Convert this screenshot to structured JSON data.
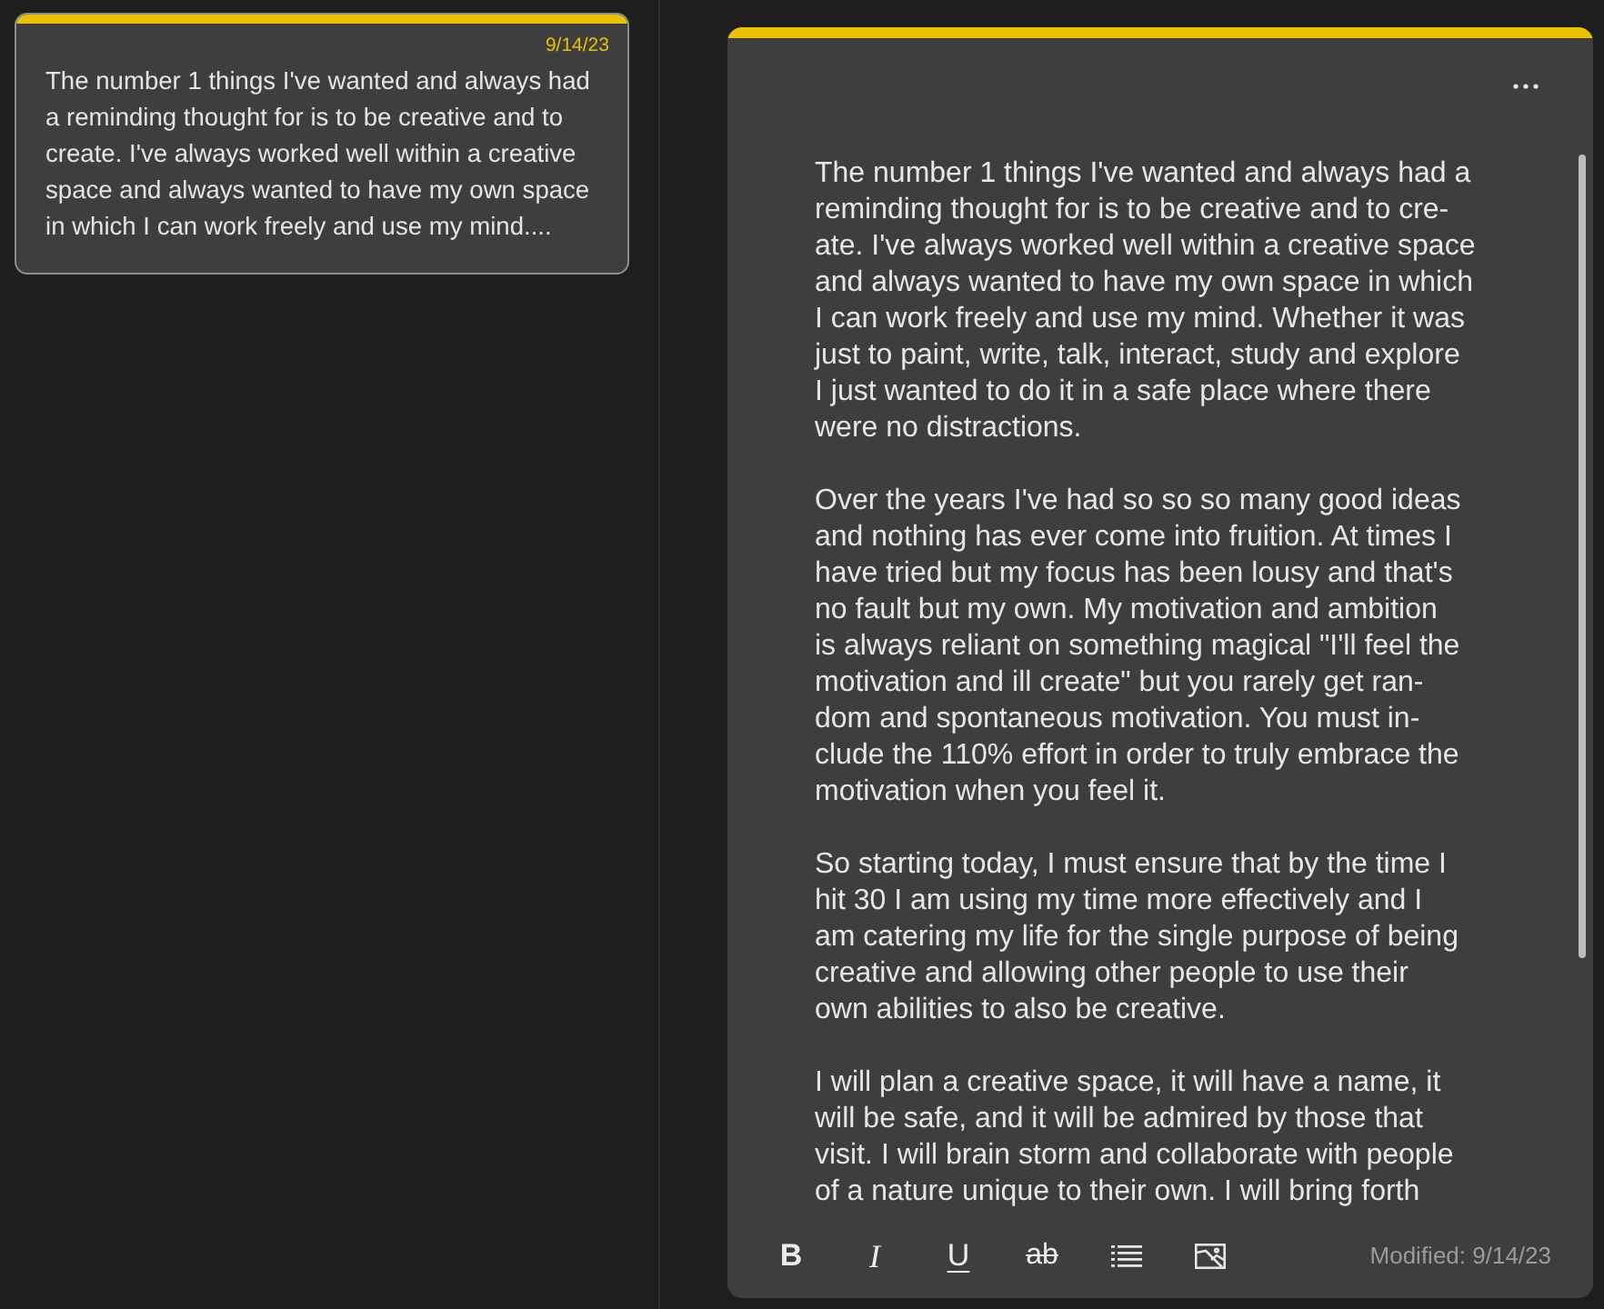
{
  "note_list": [
    {
      "selected": true,
      "date": "9/14/23",
      "preview_lines": [
        "The number 1 things I've wanted and always had",
        "a reminding thought for is to be creative and to",
        "create. I've always worked well within a creative",
        "space and always wanted to have my own space",
        "in which I can work freely and use my mind...."
      ]
    }
  ],
  "editor": {
    "paragraphs": [
      {
        "lines": [
          "The number 1 things I've wanted and always had a",
          "reminding thought for is to be creative and to cre-",
          "ate. I've always worked well within a creative space",
          "and always wanted to have my own space in which",
          "I can work freely and use my mind. Whether it was",
          "just to paint, write, talk, interact, study and explore",
          "I just wanted to do it in a safe place where there",
          "were no distractions."
        ]
      },
      {
        "lines": [
          "Over the years I've had so so so many good ideas",
          "and nothing has ever come into fruition. At times I",
          "have tried but my focus has been lousy and that's",
          "no fault but my own. My motivation and ambition",
          "is always reliant on something magical \"I'll feel the",
          "motivation and ill create\" but you rarely get ran-",
          "dom and spontaneous motivation. You must in-",
          "clude the 110% effort in order to truly embrace the",
          "motivation when you feel it."
        ]
      },
      {
        "lines": [
          "So starting today, I must ensure that by the time I",
          "hit 30 I am using my time more effectively and I",
          "am catering my life for the single purpose of being",
          "creative and allowing other people to use their",
          "own abilities to also be creative."
        ]
      },
      {
        "lines": [
          "I will plan a creative space, it will have a name, it",
          "will be safe, and it will be admired by those that",
          "visit. I will brain storm and collaborate with people",
          "of a nature unique to their own. I will bring forth"
        ]
      }
    ],
    "toolbar": [
      {
        "kind": "bold",
        "label": "B"
      },
      {
        "kind": "italic",
        "label": "I"
      },
      {
        "kind": "underline",
        "label": "U"
      },
      {
        "kind": "strikethrough",
        "label": "ab"
      },
      {
        "kind": "list"
      },
      {
        "kind": "image"
      }
    ],
    "modified": "Modified: 9/14/23"
  }
}
